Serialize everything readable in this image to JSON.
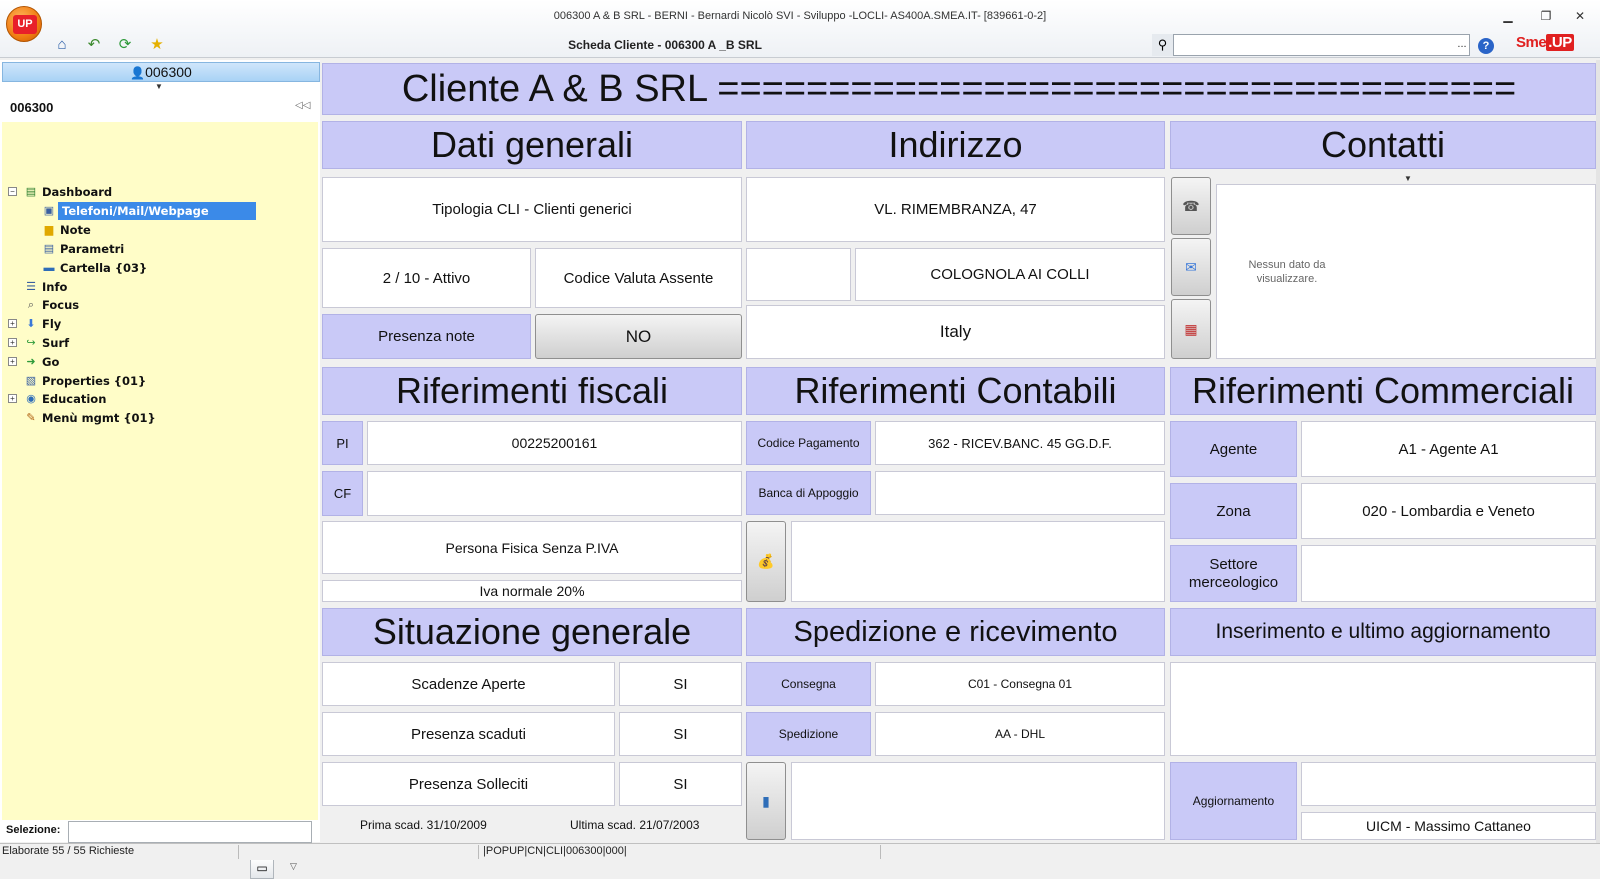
{
  "window": {
    "title": "006300 A & B SRL - BERNI - Bernardi Nicolò SVI - Sviluppo -LOCLI- AS400A.SMEA.IT- [839661-0-2]",
    "subtitle": "Scheda Cliente - 006300 A _B SRL",
    "logo_text": "UP",
    "brand": "Sme.UP",
    "search": {
      "value": "",
      "more": "..."
    }
  },
  "left": {
    "client_code": "006300",
    "tree_title": "006300",
    "tree": [
      {
        "label": "Dashboard",
        "icon": "dashboard-icon"
      },
      {
        "label": "Telefoni/Mail/Webpage",
        "icon": "contact-card-icon",
        "selected": true
      },
      {
        "label": "Note",
        "icon": "note-folder-icon"
      },
      {
        "label": "Parametri",
        "icon": "parameters-icon"
      },
      {
        "label": "Cartella {03}",
        "icon": "folder-icon"
      },
      {
        "label": "Info",
        "icon": "info-list-icon"
      },
      {
        "label": "Focus",
        "icon": "focus-icon"
      },
      {
        "label": "Fly",
        "icon": "fly-arrow-icon"
      },
      {
        "label": "Surf",
        "icon": "surf-icon"
      },
      {
        "label": "Go",
        "icon": "go-icon"
      },
      {
        "label": "Properties {01}",
        "icon": "properties-icon"
      },
      {
        "label": "Education",
        "icon": "education-icon"
      },
      {
        "label": "Menù mgmt {01}",
        "icon": "menu-mgmt-icon"
      }
    ],
    "selection_label": "Selezione:",
    "selection_value": ""
  },
  "main": {
    "title": "Cliente A & B SRL ====================================",
    "dati_generali": {
      "header": "Dati generali",
      "tipologia": "Tipologia CLI - Clienti generici",
      "stato": "2 / 10 - Attivo",
      "valuta": "Codice Valuta Assente",
      "presenza_note_label": "Presenza note",
      "presenza_note_value": "NO"
    },
    "indirizzo": {
      "header": "Indirizzo",
      "via": "VL. RIMEMBRANZA, 47",
      "cap": "",
      "citta": "COLOGNOLA AI COLLI",
      "nazione": "Italy"
    },
    "contatti": {
      "header": "Contatti",
      "empty_message": "Nessun dato da visualizzare."
    },
    "fiscali": {
      "header": "Riferimenti fiscali",
      "pi_label": "PI",
      "pi_value": "00225200161",
      "cf_label": "CF",
      "cf_value": "",
      "tipo": "Persona Fisica Senza P.IVA",
      "iva": "Iva normale 20%"
    },
    "contabili": {
      "header": "Riferimenti Contabili",
      "pagamento_label": "Codice Pagamento",
      "pagamento_value": "362 - RICEV.BANC. 45 GG.D.F.",
      "banca_label": "Banca di Appoggio",
      "banca_value": ""
    },
    "commerciali": {
      "header": "Riferimenti Commerciali",
      "agente_label": "Agente",
      "agente_value": "A1 - Agente A1",
      "zona_label": "Zona",
      "zona_value": "020 - Lombardia e Veneto",
      "settore_label": "Settore merceologico",
      "settore_value": ""
    },
    "situazione": {
      "header": "Situazione generale",
      "rows": [
        {
          "label": "Scadenze Aperte",
          "value": "SI"
        },
        {
          "label": "Presenza scaduti",
          "value": "SI"
        },
        {
          "label": "Presenza Solleciti",
          "value": "SI"
        }
      ],
      "prima_scad": "Prima scad.  31/10/2009",
      "ultima_scad": "Ultima scad.  21/07/2003"
    },
    "spedizione": {
      "header": "Spedizione e ricevimento",
      "consegna_label": "Consegna",
      "consegna_value": "C01 - Consegna 01",
      "spedizione_label": "Spedizione",
      "spedizione_value": "AA - DHL"
    },
    "inserimento": {
      "header": "Inserimento e ultimo aggiornamento",
      "aggiornamento_label": "Aggiornamento",
      "aggiornamento_date": "",
      "aggiornamento_user": "UICM - Massimo Cattaneo"
    }
  },
  "status": {
    "left": "Elaborate 55 / 55 Richieste",
    "middle": "|POPUP|CN|CLI|006300|000|"
  }
}
